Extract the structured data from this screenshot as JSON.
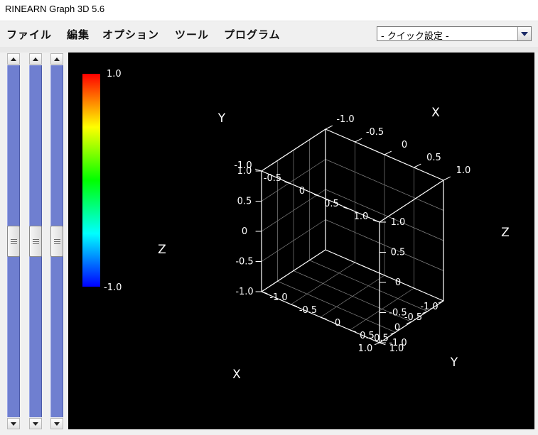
{
  "window": {
    "title": "RINEARN Graph 3D 5.6"
  },
  "menu": {
    "items": [
      "ファイル",
      "編集",
      "オプション",
      "ツール",
      "プログラム"
    ]
  },
  "quick_settings": {
    "selected": "- クイック設定 -"
  },
  "sliders": [
    {
      "name": "slider-1",
      "value": 0.5
    },
    {
      "name": "slider-2",
      "value": 0.5
    },
    {
      "name": "slider-3",
      "value": 0.5
    }
  ],
  "colors": {
    "plot_background": "#000000",
    "axis_line": "#ffffff",
    "grid_line": "#808080",
    "slider_track": "#6f7fd0"
  },
  "color_bar": {
    "max_label": "1.0",
    "min_label": "-1.0"
  },
  "axes": {
    "axis_names": {
      "x": "X",
      "y": "Y",
      "z": "Z"
    },
    "ticks": [
      "-1.0",
      "-0.5",
      "0",
      "0.5",
      "1.0"
    ]
  }
}
